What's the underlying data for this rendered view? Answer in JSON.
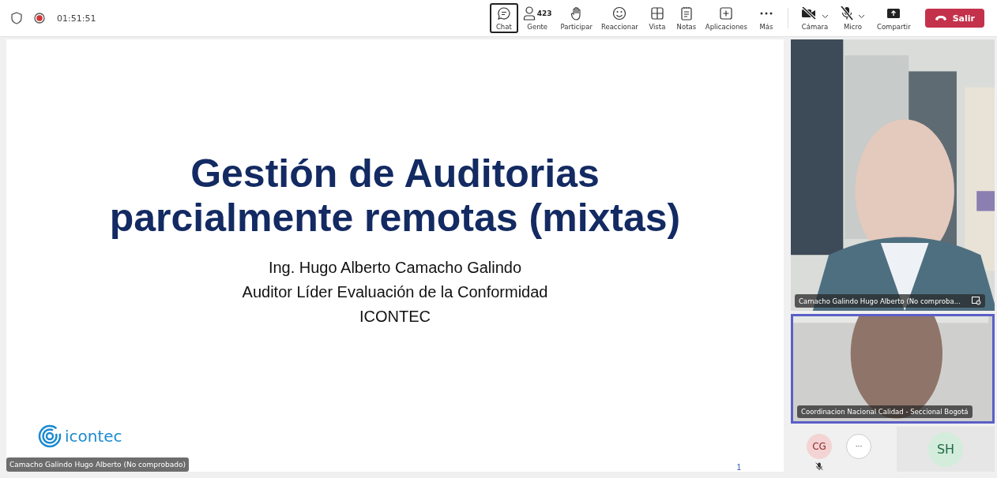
{
  "top_bar": {
    "recording": true,
    "timer": "01:51:51"
  },
  "toolbar": [
    {
      "kind": "chat",
      "label": "Chat",
      "selected": true
    },
    {
      "kind": "people",
      "label": "Gente",
      "count": "423",
      "selected": false
    },
    {
      "kind": "raise",
      "label": "Participar",
      "selected": false
    },
    {
      "kind": "react",
      "label": "Reaccionar",
      "selected": false
    },
    {
      "kind": "view",
      "label": "Vista",
      "selected": false
    },
    {
      "kind": "notes",
      "label": "Notas",
      "selected": false
    },
    {
      "kind": "apps",
      "label": "Aplicaciones",
      "selected": false
    },
    {
      "kind": "more",
      "label": "Más",
      "selected": false
    }
  ],
  "devices": [
    {
      "kind": "camera",
      "label": "Cámara",
      "off": true,
      "dropdown": true
    },
    {
      "kind": "mic",
      "label": "Micro",
      "off": true,
      "dropdown": true
    },
    {
      "kind": "share",
      "label": "Compartir"
    }
  ],
  "leave_button": {
    "label": "Salir"
  },
  "slide": {
    "title_lines": [
      "Gestión de Auditorias",
      "parcialmente remotas (mixtas)"
    ],
    "subtitle_lines": [
      "Ing. Hugo Alberto Camacho Galindo",
      "Auditor Líder Evaluación de la Conformidad",
      "ICONTEC"
    ],
    "logo_text": "icontec",
    "page_number": "1"
  },
  "presenter_tag": "Camacho Galindo Hugo Alberto (No comprobado)",
  "videos": [
    {
      "name": "Camacho Galindo Hugo Alberto (No comproba...",
      "speaking": false,
      "pinned": true
    },
    {
      "name": "Coordinacion Nacional Calidad - Seccional Bogotá",
      "speaking": true,
      "pinned": false
    }
  ],
  "participants": [
    {
      "kind": "avatar",
      "initials": "CG",
      "color": "#f3d3d3",
      "muted": true
    },
    {
      "kind": "more",
      "label": "···"
    },
    {
      "kind": "tile",
      "initials": "SH",
      "color": "#d3ecdc"
    }
  ]
}
